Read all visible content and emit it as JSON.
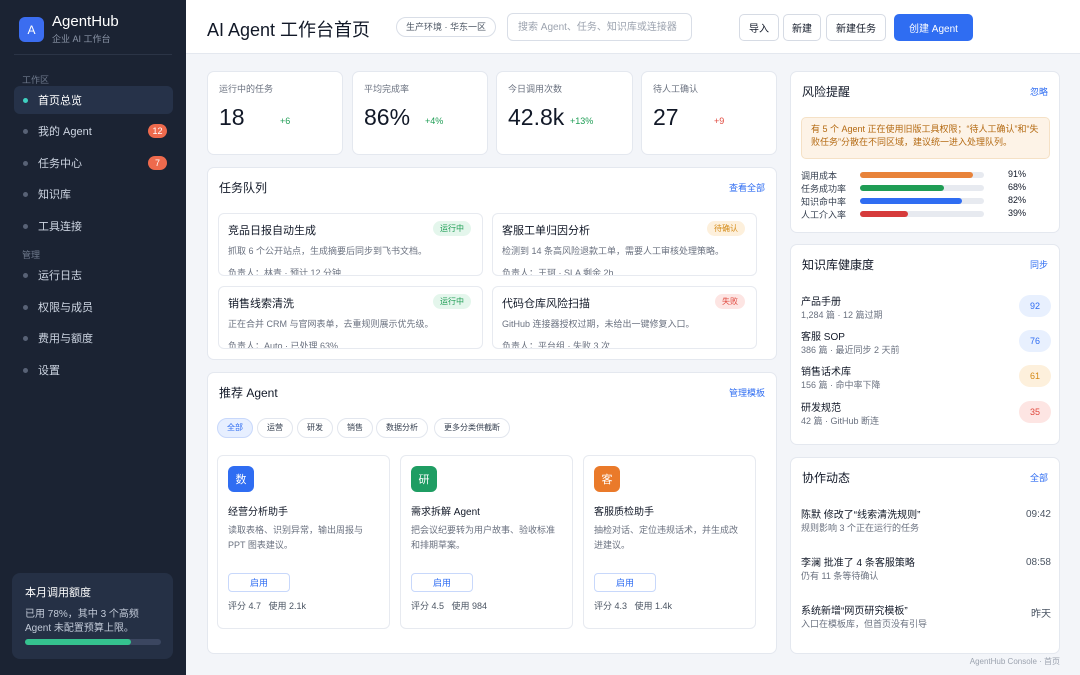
{
  "brand": {
    "logo": "A",
    "name": "AgentHub",
    "sub": "企业 AI 工作台"
  },
  "sidebar": {
    "sections": [
      {
        "label": "工作区"
      },
      {
        "label": "管理"
      }
    ],
    "items": [
      {
        "label": "首页总览",
        "active": true
      },
      {
        "label": "我的 Agent",
        "badge": "12"
      },
      {
        "label": "任务中心",
        "badge": "7"
      },
      {
        "label": "知识库"
      },
      {
        "label": "工具连接"
      },
      {
        "label": "运行日志"
      },
      {
        "label": "权限与成员"
      },
      {
        "label": "费用与额度"
      },
      {
        "label": "设置"
      }
    ],
    "quota": {
      "title": "本月调用额度",
      "desc": "已用 78%，其中 3 个高频 Agent 未配置预算上限。",
      "progress": 0.78
    }
  },
  "header": {
    "title": "AI Agent 工作台首页",
    "env": "生产环境 · 华东一区",
    "search_placeholder": "搜索 Agent、任务、知识库或连接器",
    "buttons": {
      "import": "导入",
      "new": "新建",
      "new_task": "新建任务",
      "create_agent": "创建 Agent"
    }
  },
  "stats": [
    {
      "label": "运行中的任务",
      "value": "18",
      "delta": "+6",
      "trend": "up"
    },
    {
      "label": "平均完成率",
      "value": "86%",
      "delta": "+4%",
      "trend": "up"
    },
    {
      "label": "今日调用次数",
      "value": "42.8k",
      "delta": "+13%",
      "trend": "up"
    },
    {
      "label": "待人工确认",
      "value": "27",
      "delta": "+9",
      "trend": "down"
    }
  ],
  "queue": {
    "title": "任务队列",
    "link": "查看全部",
    "tasks": [
      {
        "name": "竞品日报自动生成",
        "status": "运行中",
        "tone": "green",
        "desc": "抓取 6 个公开站点，生成摘要后同步到飞书文档。",
        "meta": "负责人：林青 · 预计 12 分钟"
      },
      {
        "name": "客服工单归因分析",
        "status": "待确认",
        "tone": "amber",
        "desc": "检测到 14 条高风险退款工单，需要人工审核处理策略。",
        "meta": "负责人：王珂 · SLA 剩余 2h"
      },
      {
        "name": "销售线索清洗",
        "status": "运行中",
        "tone": "green",
        "desc": "正在合并 CRM 与官网表单，去重规则展示优先级。",
        "meta": "负责人：Auto · 已处理 63%"
      },
      {
        "name": "代码仓库风险扫描",
        "status": "失败",
        "tone": "red",
        "desc": "GitHub 连接器授权过期，未给出一键修复入口。",
        "meta": "负责人：平台组 · 失败 3 次"
      }
    ]
  },
  "recommend": {
    "title": "推荐 Agent",
    "link": "管理模板",
    "filters": [
      "全部",
      "运营",
      "研发",
      "销售",
      "数据分析",
      "更多分类供截断"
    ],
    "agents": [
      {
        "icon": "数",
        "color": "#2f6df2",
        "name": "经营分析助手",
        "desc": "读取表格、识别异常，输出周报与 PPT 图表建议。",
        "button": "启用",
        "rating": "评分 4.7",
        "usage": "使用 2.1k"
      },
      {
        "icon": "研",
        "color": "#1f9d63",
        "name": "需求拆解 Agent",
        "desc": "把会议纪要转为用户故事、验收标准和排期草案。",
        "button": "启用",
        "rating": "评分 4.5",
        "usage": "使用 984"
      },
      {
        "icon": "客",
        "color": "#ea7a2a",
        "name": "客服质检助手",
        "desc": "抽检对话、定位违规话术，并生成改进建议。",
        "button": "启用",
        "rating": "评分 4.3",
        "usage": "使用 1.4k"
      }
    ]
  },
  "risk": {
    "title": "风险提醒",
    "link": "忽略",
    "alert": "有 5 个 Agent 正在使用旧版工具权限；“待人工确认”和“失败任务”分散在不同区域，建议统一进入处理队列。",
    "metrics": [
      {
        "label": "调用成本",
        "value": "91%",
        "progress": 0.91,
        "color": "#e8833a"
      },
      {
        "label": "任务成功率",
        "value": "68%",
        "progress": 0.68,
        "color": "#1f9d55"
      },
      {
        "label": "知识命中率",
        "value": "82%",
        "progress": 0.82,
        "color": "#2f6df2"
      },
      {
        "label": "人工介入率",
        "value": "39%",
        "progress": 0.39,
        "color": "#d63b3b"
      }
    ]
  },
  "kb": {
    "title": "知识库健康度",
    "link": "同步",
    "items": [
      {
        "name": "产品手册",
        "meta": "1,284 篇 · 12 篇过期",
        "score": "92",
        "bg": "#e8f0fe",
        "fg": "#2f6df2"
      },
      {
        "name": "客服 SOP",
        "meta": "386 篇 · 最近同步 2 天前",
        "score": "76",
        "bg": "#e8f0fe",
        "fg": "#2f6df2"
      },
      {
        "name": "销售话术库",
        "meta": "156 篇 · 命中率下降",
        "score": "61",
        "bg": "#fdf0dc",
        "fg": "#d48a16"
      },
      {
        "name": "研发规范",
        "meta": "42 篇 · GitHub 断连",
        "score": "35",
        "bg": "#fde5e3",
        "fg": "#e0483d"
      }
    ]
  },
  "activity": {
    "title": "协作动态",
    "link": "全部",
    "items": [
      {
        "title": "陈默 修改了“线索清洗规则”",
        "sub": "规则影响 3 个正在运行的任务",
        "time": "09:42"
      },
      {
        "title": "李澜 批准了 4 条客服策略",
        "sub": "仍有 11 条等待确认",
        "time": "08:58"
      },
      {
        "title": "系统新增“网页研究模板”",
        "sub": "入口在模板库，但首页没有引导",
        "time": "昨天"
      }
    ]
  },
  "footer": "AgentHub Console · 首页"
}
